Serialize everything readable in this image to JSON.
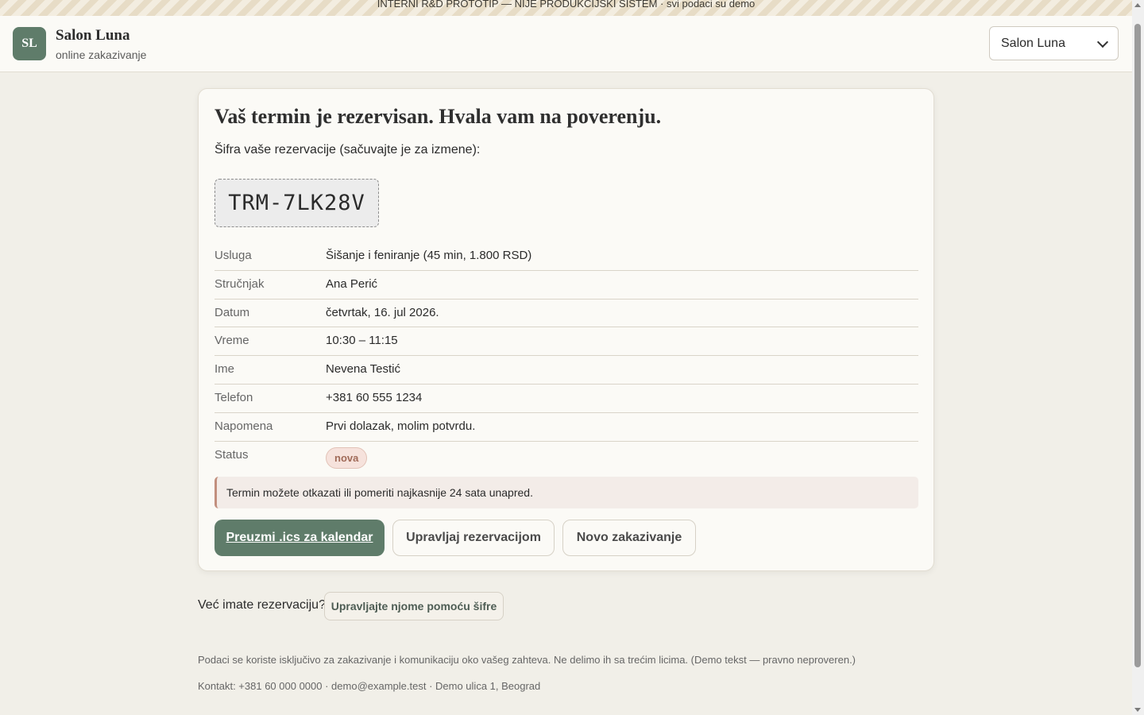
{
  "banner": {
    "text": "INTERNI R&D PROTOTIP — NIJE PRODUKCIJSKI SISTEM · svi podaci su demo"
  },
  "header": {
    "logo_initials": "SL",
    "brand_name": "Salon Luna",
    "brand_subtitle": "online zakazivanje",
    "salon_select": {
      "selected": "Salon Luna"
    }
  },
  "confirmation": {
    "title": "Vaš termin je rezervisan. Hvala vam na poverenju.",
    "code_intro": "Šifra vaše rezervacije (sačuvajte je za izmene):",
    "code": "TRM-7LK28V",
    "details": [
      {
        "label": "Usluga",
        "value": "Šišanje i feniranje (45 min, 1.800 RSD)"
      },
      {
        "label": "Stručnjak",
        "value": "Ana Perić"
      },
      {
        "label": "Datum",
        "value": "četvrtak, 16. jul 2026."
      },
      {
        "label": "Vreme",
        "value": "10:30 – 11:15"
      },
      {
        "label": "Ime",
        "value": "Nevena Testić"
      },
      {
        "label": "Telefon",
        "value": "+381 60 555 1234"
      },
      {
        "label": "Napomena",
        "value": "Prvi dolazak, molim potvrdu."
      },
      {
        "label": "Status",
        "value": "nova"
      }
    ],
    "notice": "Termin možete otkazati ili pomeriti najkasnije 24 sata unapred.",
    "buttons": {
      "download_ics": "Preuzmi .ics za kalendar",
      "manage": "Upravljaj rezervacijom",
      "new_booking": "Novo zakazivanje"
    }
  },
  "already": {
    "text": "Već imate rezervaciju?",
    "button": "Upravljajte njome pomoću šifre"
  },
  "footer": {
    "privacy": "Podaci se koriste isključivo za zakazivanje i komunikaciju oko vašeg zahteva. Ne delimo ih sa trećim licima. (Demo tekst — pravno neproveren.)",
    "contact": "Kontakt: +381 60 000 0000 · demo@example.test · Demo ulica 1, Beograd"
  },
  "colors": {
    "accent": "#5f7c6a",
    "background": "#f1efe8",
    "status_badge": "#f6e2dc",
    "notice_border": "#c28f7e"
  }
}
